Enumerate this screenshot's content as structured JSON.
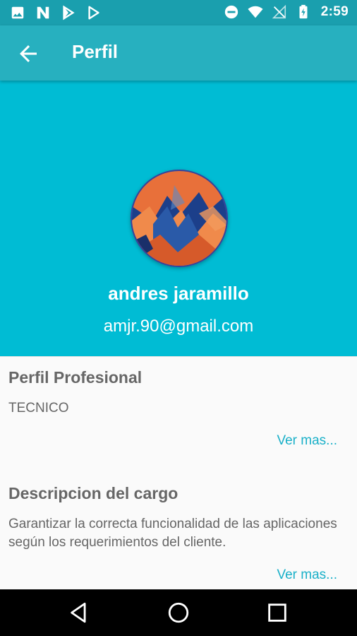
{
  "status_bar": {
    "time": "2:59",
    "left_icons": [
      "image-icon",
      "n-notification-icon",
      "play-store-alt-icon",
      "play-store-icon"
    ],
    "right_icons": [
      "do-not-disturb-icon",
      "wifi-icon",
      "no-signal-icon",
      "battery-charging-icon"
    ]
  },
  "app_bar": {
    "title": "Perfil"
  },
  "profile": {
    "name": "andres jaramillo",
    "email": "amjr.90@gmail.com"
  },
  "sections": [
    {
      "title": "Perfil Profesional",
      "text": "TECNICO",
      "link": "Ver mas..."
    },
    {
      "title": "Descripcion del cargo",
      "text": "Garantizar la correcta funcionalidad de las aplicaciones según los requerimientos del cliente.",
      "link": "Ver mas..."
    }
  ],
  "colors": {
    "status_bar": "#1a9fae",
    "app_bar": "#27b0bf",
    "header": "#00bcd4",
    "link": "#1ab0c8"
  }
}
